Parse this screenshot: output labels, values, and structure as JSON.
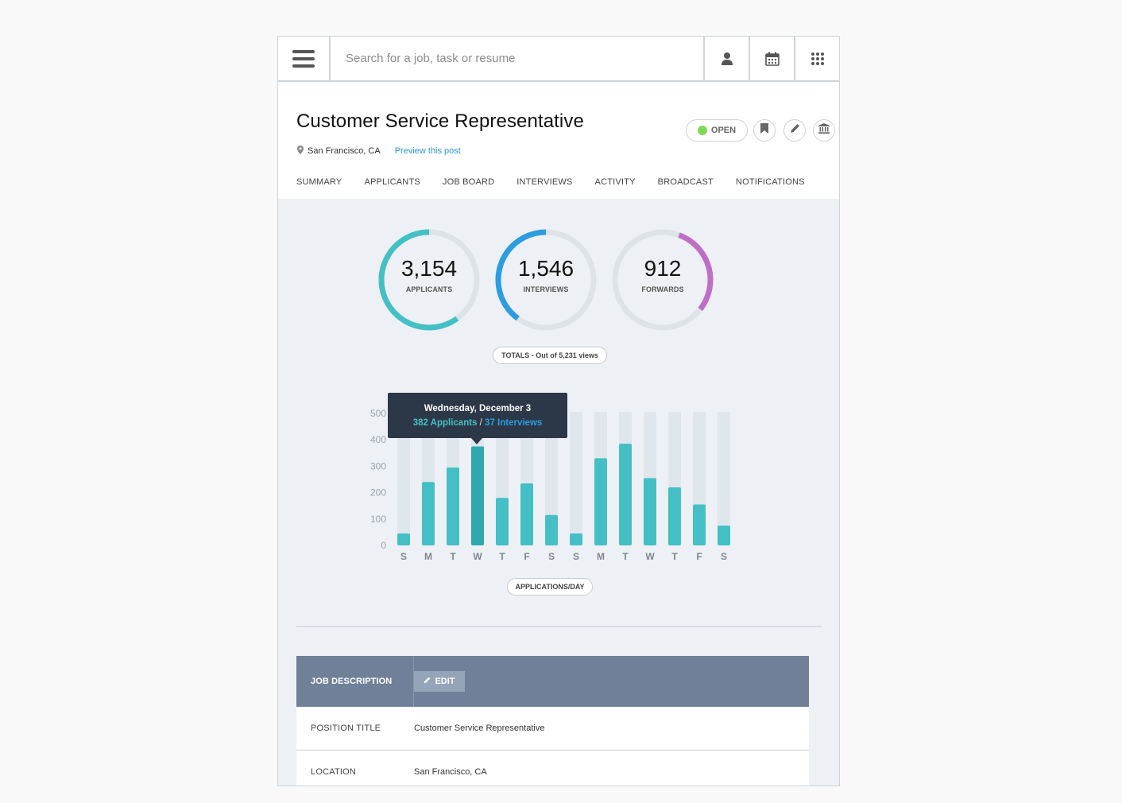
{
  "search": {
    "placeholder": "Search for a job, task or resume"
  },
  "job": {
    "title": "Customer Service Representative",
    "location": "San Francisco, CA",
    "preview_link": "Preview this post",
    "status": "OPEN"
  },
  "tabs": [
    "SUMMARY",
    "APPLICANTS",
    "JOB BOARD",
    "INTERVIEWS",
    "ACTIVITY",
    "BROADCAST",
    "NOTIFICATIONS"
  ],
  "stats": {
    "applicants": {
      "value": "3,154",
      "label": "APPLICANTS",
      "fraction": 0.6,
      "color": "#45bfc6"
    },
    "interviews": {
      "value": "1,546",
      "label": "INTERVIEWS",
      "fraction": 0.4,
      "color": "#2b9de0"
    },
    "forwards": {
      "value": "912",
      "label": "FORWARDS",
      "fraction": 0.3,
      "color": "#bf6ec6"
    },
    "totals_label": "TOTALS - Out of 5,231 views"
  },
  "tooltip": {
    "date": "Wednesday, December 3",
    "applicants": "382 Applicants",
    "separator": " / ",
    "interviews": "37 Interviews"
  },
  "chart_data": {
    "type": "bar",
    "categories": [
      "S",
      "M",
      "T",
      "W",
      "T",
      "F",
      "S",
      "S",
      "M",
      "T",
      "W",
      "T",
      "F",
      "S"
    ],
    "values": [
      45,
      240,
      295,
      375,
      180,
      235,
      115,
      45,
      330,
      385,
      255,
      220,
      155,
      75
    ],
    "ylim": [
      0,
      530
    ],
    "yticks": [
      0,
      100,
      200,
      300,
      400,
      500
    ],
    "label": "APPLICATIONS/DAY"
  },
  "job_description": {
    "header": "JOB DESCRIPTION",
    "edit_label": "EDIT",
    "rows": [
      {
        "key": "POSITION TITLE",
        "value": "Customer Service Representative"
      },
      {
        "key": "LOCATION",
        "value": "San Francisco, CA"
      }
    ]
  }
}
